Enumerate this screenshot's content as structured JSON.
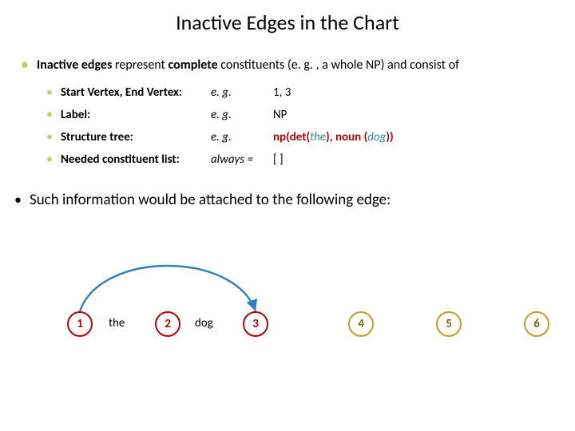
{
  "title": "Inactive Edges in the Chart",
  "intro": {
    "lead_bold1": "Inactive edges",
    "lead_mid": " represent ",
    "lead_bold2": "complete",
    "lead_tail": " constituents (e. g. , a whole NP) and consist of"
  },
  "rows": [
    {
      "label": "Start Vertex, End Vertex:",
      "eg": "e. g.",
      "val": "1, 3"
    },
    {
      "label": "Label:",
      "eg": "e. g.",
      "val": "NP"
    },
    {
      "label": "Structure tree:",
      "eg": "e. g.",
      "val_pre": "np(det(",
      "val_the": "the",
      "val_mid": "), noun (",
      "val_dog": "dog",
      "val_post": "))"
    },
    {
      "label": "Needed constituent list:",
      "eg": "always =",
      "val": "[ ]"
    }
  ],
  "second": "Such information would be attached to the following edge:",
  "nodes": {
    "n1": "1",
    "n2": "2",
    "n3": "3",
    "n4": "4",
    "n5": "5",
    "n6": "6"
  },
  "words": {
    "w1": "the",
    "w2": "dog"
  }
}
